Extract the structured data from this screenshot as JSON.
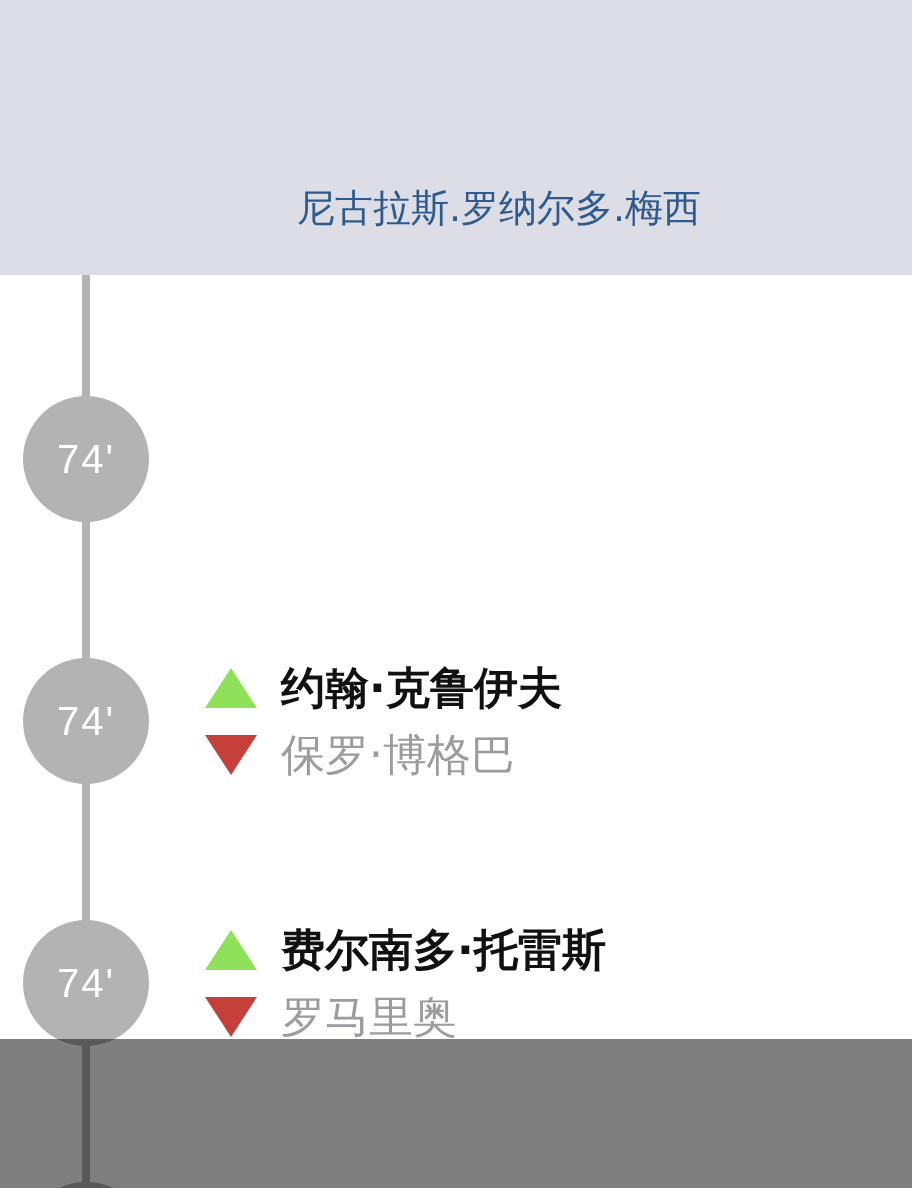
{
  "header": {
    "title": "尼古拉斯.罗纳尔多.梅西"
  },
  "timeline": {
    "events": [
      {
        "minute": "74'"
      },
      {
        "minute": "74'",
        "players": [
          {
            "kind": "in",
            "name": "约翰·克鲁伊夫"
          },
          {
            "kind": "out",
            "name": "保罗·博格巴"
          }
        ]
      },
      {
        "minute": "74'",
        "players": [
          {
            "kind": "in",
            "name": "费尔南多·托雷斯"
          },
          {
            "kind": "out",
            "name": "罗马里奥"
          }
        ]
      }
    ]
  },
  "overlay": {
    "visible": true
  }
}
